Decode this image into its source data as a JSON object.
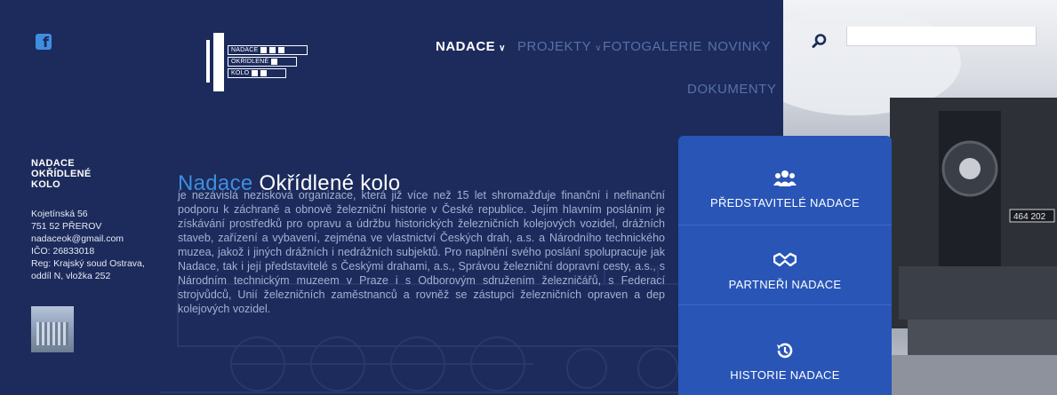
{
  "social": {
    "facebook_icon": "facebook-icon"
  },
  "logo": {
    "lines": [
      "NADACE",
      "OKŘÍDLENÉ",
      "KOLO"
    ]
  },
  "nav": {
    "items": [
      {
        "label": "NADACE",
        "active": true,
        "has_dropdown": true
      },
      {
        "label": "PROJEKTY",
        "active": false,
        "has_dropdown": true
      },
      {
        "label": "FOTOGALERIE",
        "active": false,
        "has_dropdown": false
      },
      {
        "label": "NOVINKY",
        "active": false,
        "has_dropdown": false
      },
      {
        "label": "DOKUMENTY",
        "active": false,
        "has_dropdown": false
      }
    ]
  },
  "search": {
    "placeholder": "",
    "icon": "search-icon"
  },
  "sidebar": {
    "org_lines": [
      "NADACE",
      "OKŘÍDLENÉ",
      "KOLO"
    ],
    "address_lines": [
      "Kojetínská 56",
      "751 52 PŘEROV",
      "nadaceok@gmail.com",
      "IČO: 26833018",
      "Reg: Krajský soud Ostrava,",
      "oddíl N, vložka 252"
    ]
  },
  "main": {
    "title_highlight": "Nadace",
    "title_rest": "Okřídlené kolo",
    "text": "je nezávislá nezisková organizace, která již více než 15 let shromažďuje finanční i nefinanční podporu k záchraně a obnově železniční historie v České republice. Jejím hlavním posláním je získávání prostředků pro opravu a údržbu historických železničních kolejových vozidel, drážních staveb, zařízení a vybavení, zejména ve vlastnictví Českých drah, a.s. a Národního technického muzea, jakož i jiných drážních i nedrážních subjektů. Pro naplnění svého poslání spolupracuje jak Nadace, tak i její představitelé s Českými drahami, a.s., Správou železniční dopravní cesty, a.s., s Národním technickým muzeem v Praze i s Odborovým sdružením železničářů, s Federací strojvůdců, Unií železničních zaměstnanců a rovněž se zástupci železničních opraven a dep kolejových vozidel."
  },
  "side_menu": {
    "items": [
      {
        "label": "PŘEDSTAVITELÉ NADACE",
        "icon": "users-icon"
      },
      {
        "label": "PARTNEŘI NADACE",
        "icon": "handshake-icon"
      },
      {
        "label": "HISTORIE NADACE",
        "icon": "history-icon"
      }
    ]
  },
  "photo": {
    "locomotive_number": "464 202"
  },
  "colors": {
    "navy": "#1c2b5c",
    "accent_blue": "#3f8ee0",
    "menu_blue": "#2955b7"
  }
}
